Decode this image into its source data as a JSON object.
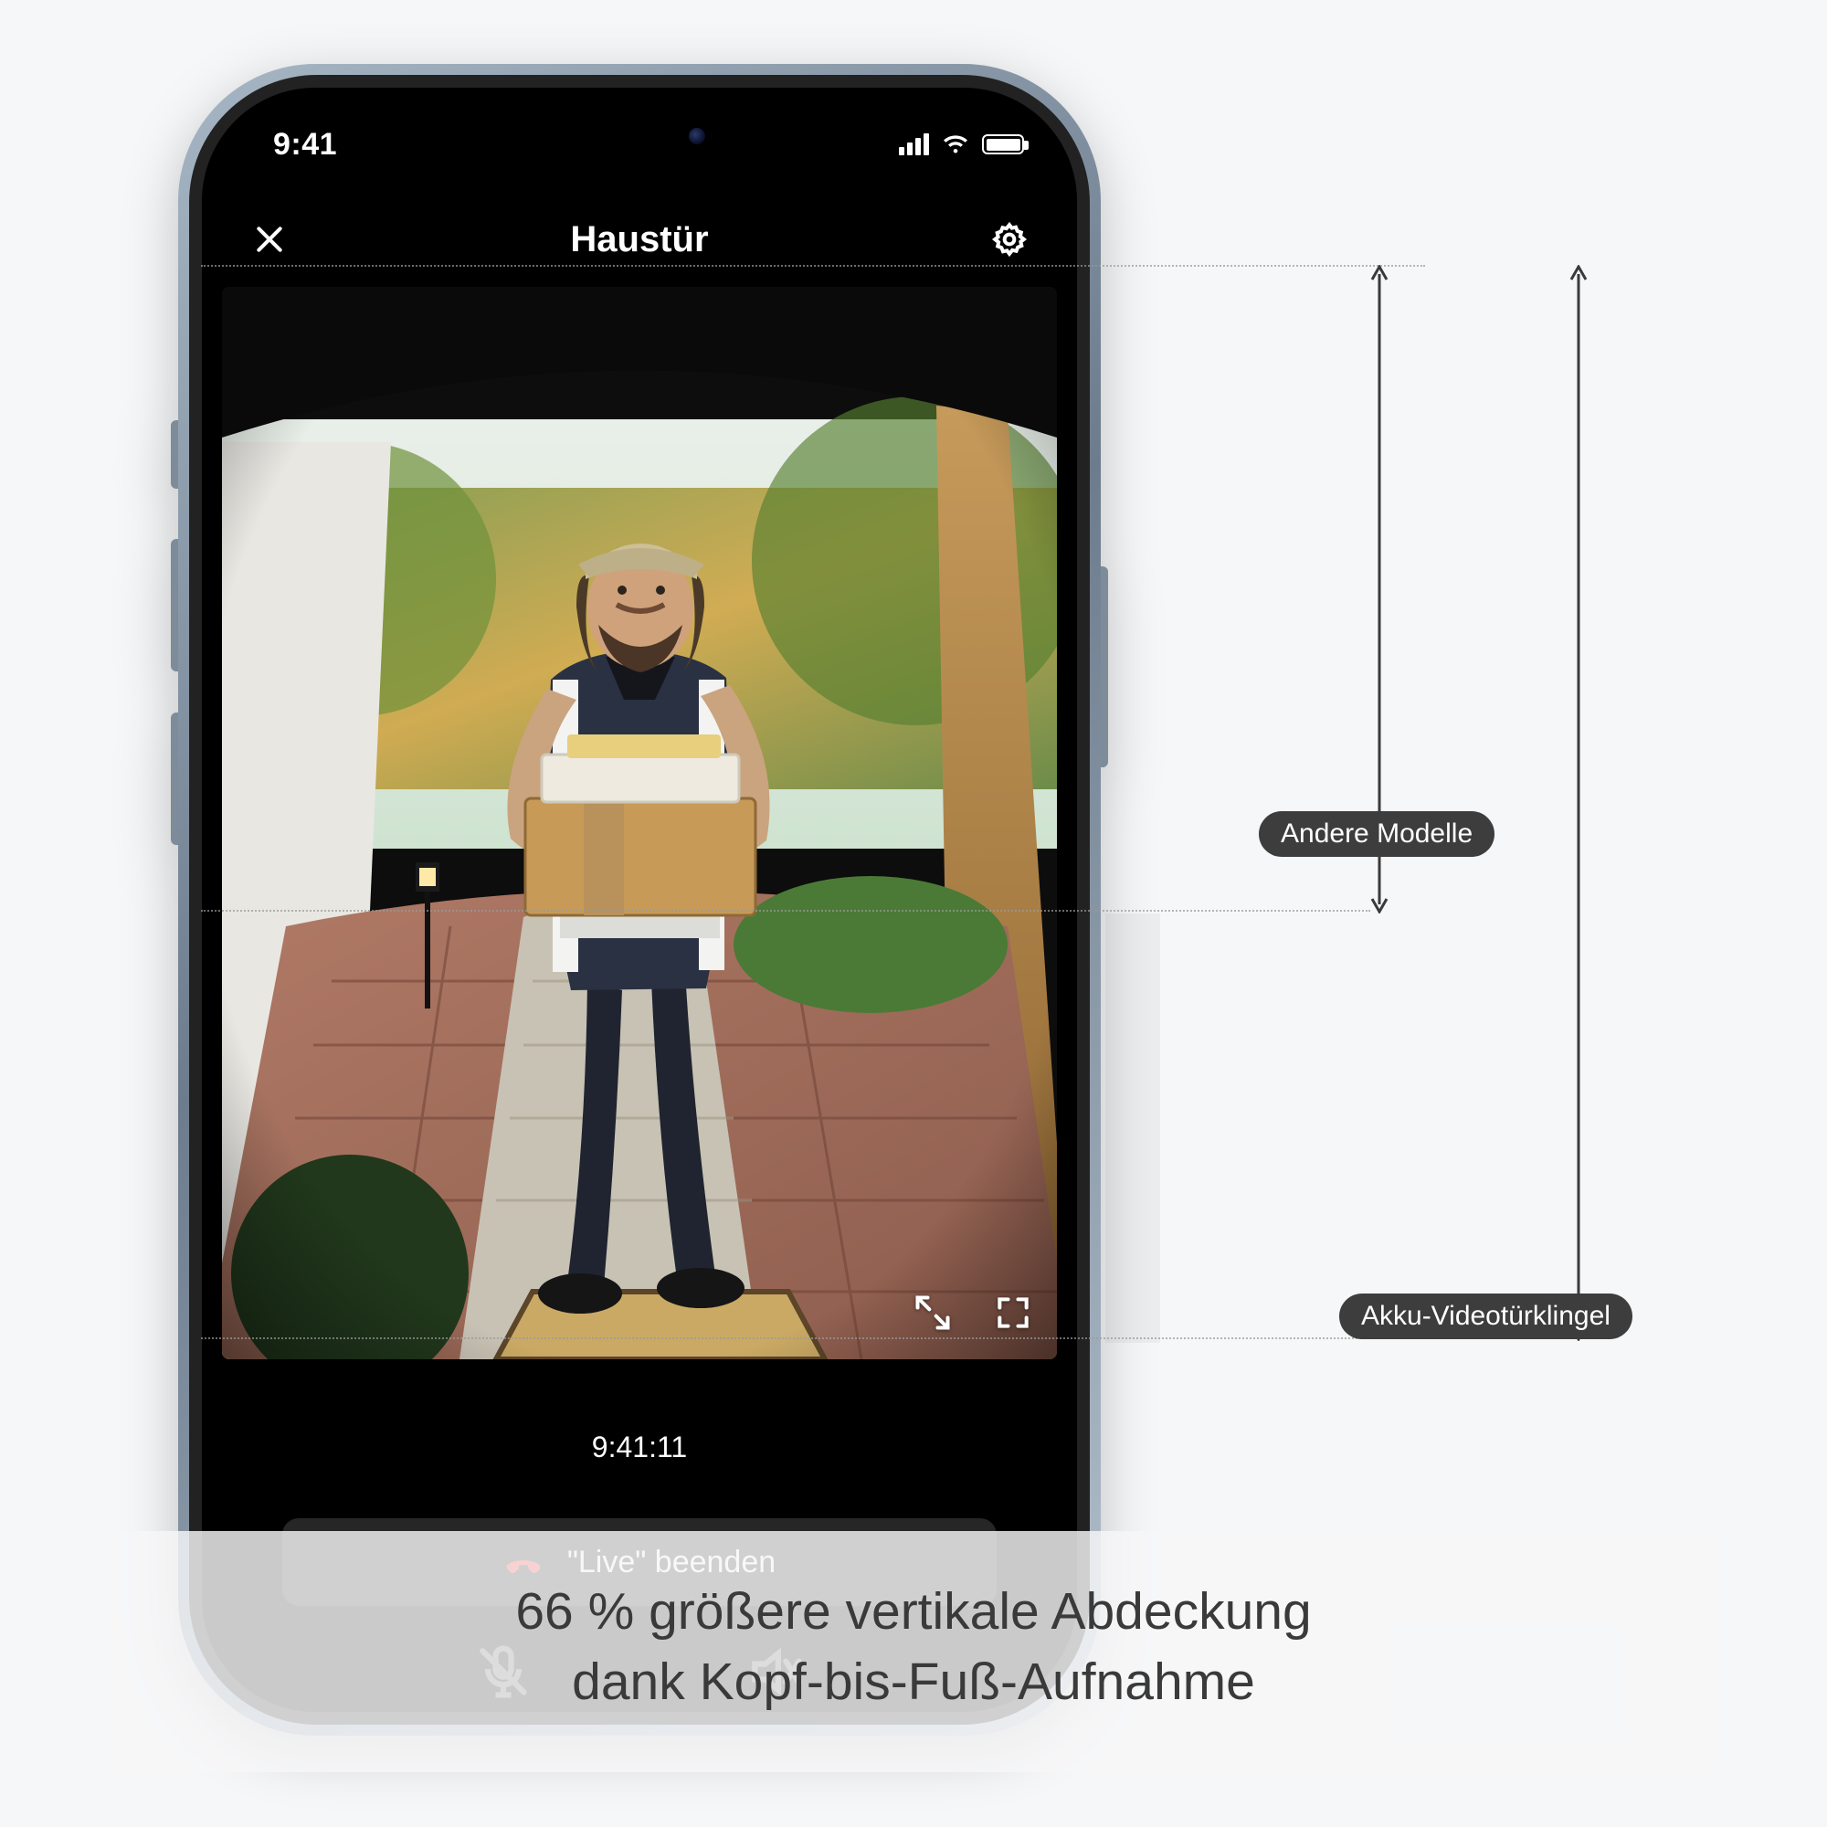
{
  "statusbar": {
    "time": "9:41"
  },
  "header": {
    "title": "Haustür"
  },
  "video": {
    "timestamp": "9:41:11"
  },
  "controls": {
    "end_live_label": "\"Live\" beenden"
  },
  "compare": {
    "other_models_label": "Andere Modelle",
    "this_model_label": "Akku-Videotürklingel"
  },
  "caption": {
    "line1": "66 % größere vertikale Abdeckung",
    "line2": "dank Kopf-bis-Fuß-Aufnahme"
  }
}
